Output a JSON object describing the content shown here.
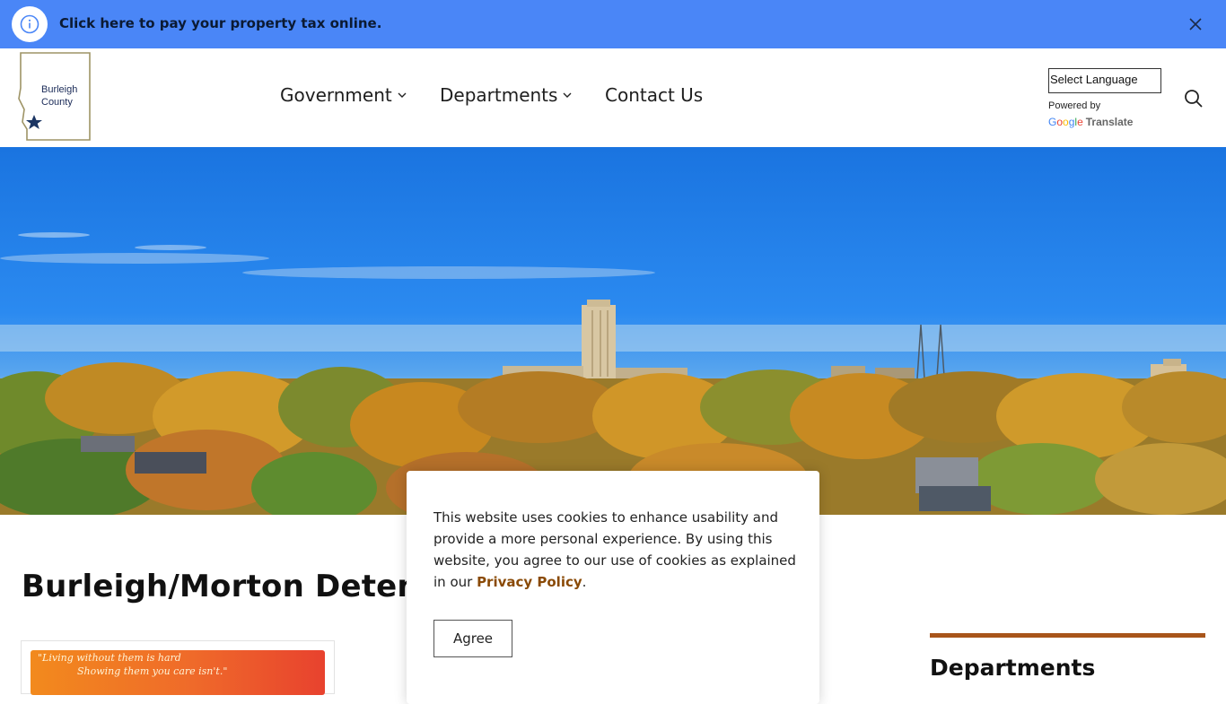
{
  "alert": {
    "text": "Click here to pay your property tax online.",
    "icon": "info-icon",
    "close_icon": "close-icon"
  },
  "header": {
    "logo_text_line1": "Burleigh",
    "logo_text_line2": "County",
    "nav": [
      {
        "label": "Government",
        "has_dropdown": true
      },
      {
        "label": "Departments",
        "has_dropdown": true
      },
      {
        "label": "Contact Us",
        "has_dropdown": false
      }
    ],
    "language_select": "Select Language",
    "powered_by": "Powered by",
    "translate_label": "Translate",
    "search_icon": "search-icon"
  },
  "main": {
    "page_title": "Burleigh/Morton Detentio",
    "card_quote_line1": "\"Living without them is hard",
    "card_quote_line2": "Showing them you care isn't.\""
  },
  "sidebar": {
    "heading": "Departments"
  },
  "cookie_banner": {
    "text": "This website uses cookies to enhance usability and provide a more personal experience. By using this website, you agree to our use of cookies as explained in our ",
    "link_text": "Privacy Policy",
    "text_end": ".",
    "agree_label": "Agree"
  },
  "colors": {
    "alert_bg": "#4a86f7",
    "accent_rule": "#a8551a",
    "link": "#8a4a06"
  }
}
